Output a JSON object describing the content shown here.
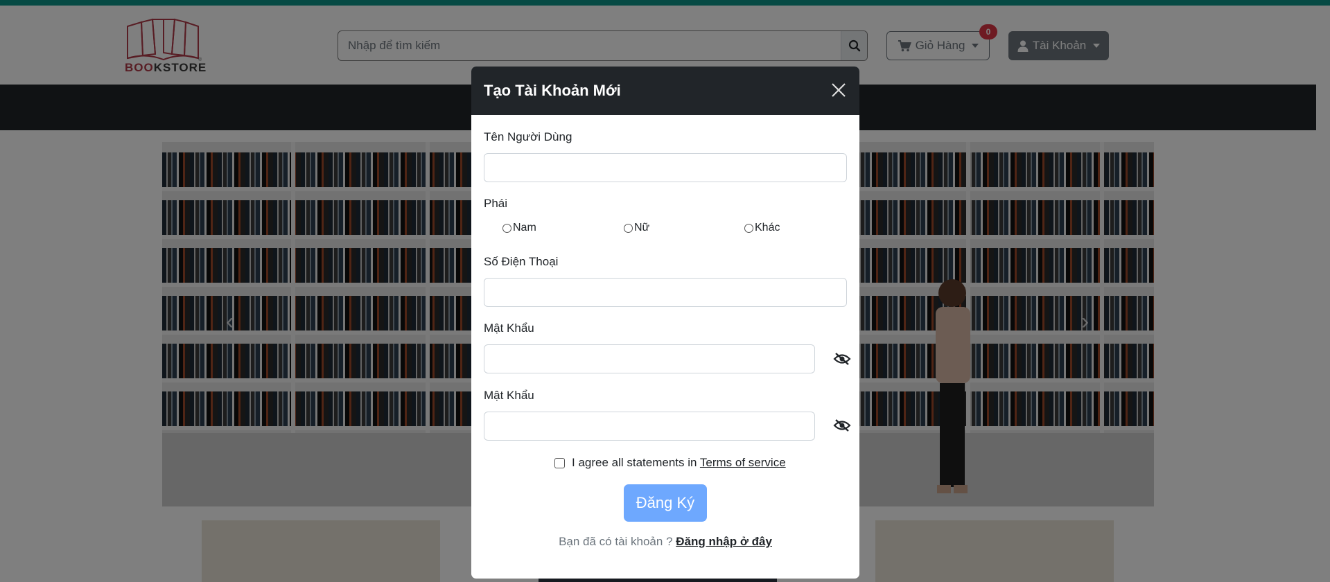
{
  "header": {
    "logo_text_accent": "BOO",
    "logo_text_rest": "KSTORE",
    "logo_registered": "®",
    "search": {
      "placeholder": "Nhập để tìm kiếm",
      "value": ""
    },
    "cart": {
      "label": "Giỏ Hàng",
      "count": "0"
    },
    "account": {
      "label": "Tài Khoản"
    }
  },
  "hero": {
    "prev_arrow": "‹",
    "next_arrow": "›"
  },
  "modal": {
    "title": "Tạo Tài Khoản Mới",
    "fields": {
      "username_label": "Tên Người Dùng",
      "gender_label": "Phái",
      "gender_options": [
        "Nam",
        "Nữ",
        "Khác"
      ],
      "phone_label": "Số Điện Thoại",
      "password_label": "Mật Khẩu",
      "confirm_password_label": "Mật Khẩu"
    },
    "agree_text": "I agree all statements in",
    "terms_link": "Terms of service",
    "submit_label": "Đăng Ký",
    "login_prompt": "Bạn đã có tài khoản ?",
    "login_link": "Đăng nhập ở đây"
  },
  "colors": {
    "accent_bar": "#0d9488",
    "header_dark": "#212529",
    "submit": "#6ea8fe",
    "badge": "#dc3545"
  }
}
